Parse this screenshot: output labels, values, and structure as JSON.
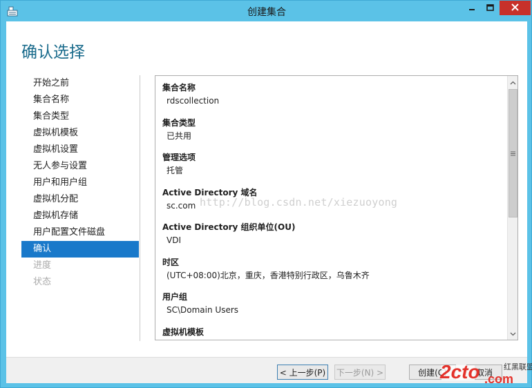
{
  "window": {
    "title": "创建集合"
  },
  "page_title": "确认选择",
  "steps": [
    {
      "label": "开始之前",
      "state": "normal"
    },
    {
      "label": "集合名称",
      "state": "normal"
    },
    {
      "label": "集合类型",
      "state": "normal"
    },
    {
      "label": "虚拟机模板",
      "state": "normal"
    },
    {
      "label": "虚拟机设置",
      "state": "normal"
    },
    {
      "label": "无人参与设置",
      "state": "normal"
    },
    {
      "label": "用户和用户组",
      "state": "normal"
    },
    {
      "label": "虚拟机分配",
      "state": "normal"
    },
    {
      "label": "虚拟机存储",
      "state": "normal"
    },
    {
      "label": "用户配置文件磁盘",
      "state": "normal"
    },
    {
      "label": "确认",
      "state": "active"
    },
    {
      "label": "进度",
      "state": "disabled"
    },
    {
      "label": "状态",
      "state": "disabled"
    }
  ],
  "details": [
    {
      "label": "集合名称",
      "value": "rdscollection"
    },
    {
      "label": "集合类型",
      "value": "已共用"
    },
    {
      "label": "管理选项",
      "value": "托管"
    },
    {
      "label": "Active Directory 域名",
      "value": "sc.com"
    },
    {
      "label": "Active Directory 组织单位(OU)",
      "value": "VDI"
    },
    {
      "label": "时区",
      "value": "(UTC+08:00)北京，重庆，香港特别行政区，乌鲁木齐"
    },
    {
      "label": "用户组",
      "value": "SC\\Domain Users"
    },
    {
      "label": "虚拟机模板",
      "value": ""
    }
  ],
  "watermark": "http://blog.csdn.net/xiezuoyong",
  "buttons": {
    "prev": "< 上一步(P)",
    "next": "下一步(N) >",
    "create": "创建(C)",
    "cancel": "取消"
  },
  "logo": {
    "text1": "2cto",
    "text2": ".com",
    "text3": "红黑联盟"
  },
  "colors": {
    "accent": "#1979ca",
    "title": "#186a8b",
    "frame": "#5bc2e7",
    "close": "#c7312a"
  },
  "icons": [
    "app-icon",
    "minimize-icon",
    "maximize-icon",
    "close-icon",
    "scroll-up-icon",
    "scroll-down-icon",
    "scroll-grip-icon"
  ]
}
